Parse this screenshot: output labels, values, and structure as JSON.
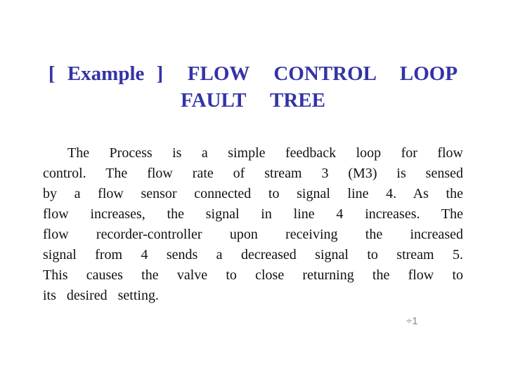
{
  "slide": {
    "title": {
      "line1": "[ Example ]  FLOW  CONTROL  LOOP",
      "line2": "FAULT  TREE"
    },
    "body_lines": [
      "The Process is a simple feedback loop for flow",
      "control. The flow rate of stream 3 (M3) is sensed",
      "by a flow sensor connected to signal line 4. As the",
      "flow increases, the signal in line 4 increases. The",
      "flow recorder-controller upon receiving the increased",
      "signal from 4 sends a decreased signal to stream 5.",
      "This causes the valve to close returning the flow to",
      "its desired setting."
    ],
    "page_number": "÷1",
    "colors": {
      "title": "#3333a6",
      "body": "#111111",
      "page_number": "#8a8a8a",
      "background": "#ffffff"
    }
  }
}
